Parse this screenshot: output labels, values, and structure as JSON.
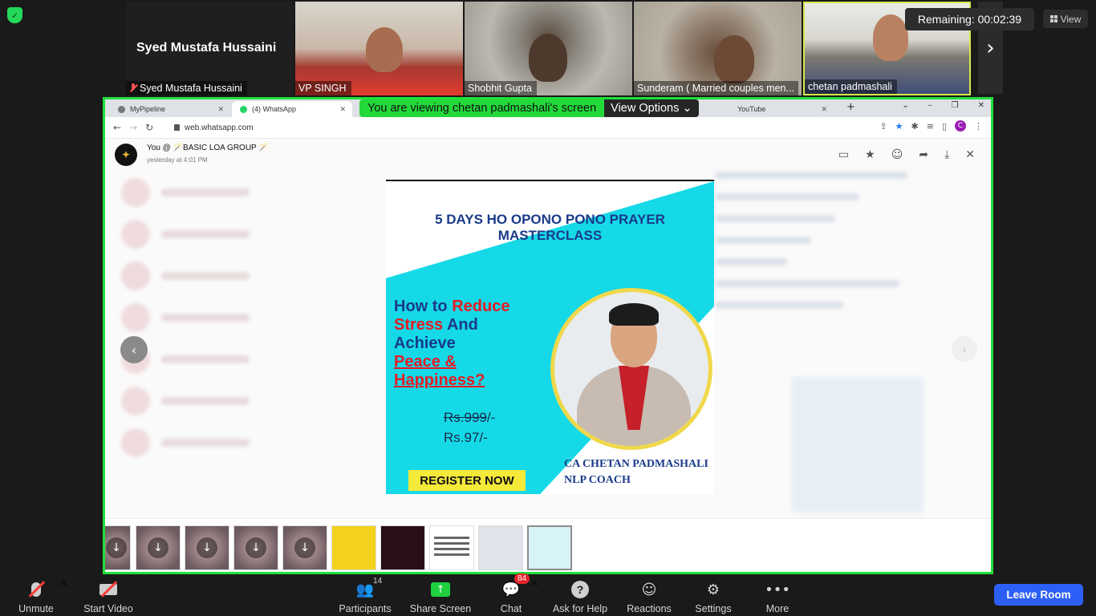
{
  "security": {
    "icon": "shield-check-icon"
  },
  "gallery": [
    {
      "name": "Syed Mustafa Hussaini",
      "big_name": "Syed Mustafa Hussaini",
      "muted": true
    },
    {
      "name": "VP SINGH"
    },
    {
      "name": "Shobhit Gupta"
    },
    {
      "name": "Sunderam ( Married couples men..."
    },
    {
      "name": "chetan padmashali",
      "active": true
    }
  ],
  "remaining": "Remaining: 00:02:39",
  "view_label": "View",
  "share": {
    "banner_text": "You are viewing chetan padmashali's screen",
    "view_options": "View Options",
    "tabs": [
      {
        "label": "MyPipeline"
      },
      {
        "label": "(4) WhatsApp"
      },
      {
        "label": "YouTube"
      }
    ],
    "url": "web.whatsapp.com",
    "avatar_letter": "C",
    "viewer": {
      "sender": "You @ 🪄BASIC LOA GROUP 🪄",
      "time": "yesterday at 4:01 PM"
    },
    "poster": {
      "title_line1": "5 DAYS HO OPONO PONO PRAYER",
      "title_line2": "MASTERCLASS",
      "q1_a": "How to ",
      "q1_b": "Reduce",
      "q2_a": "Stress",
      "q2_b": " And",
      "q3": "Achieve",
      "q4": "Peace &",
      "q5": "Happiness?",
      "old_price": "Rs.999",
      "old_price_suffix": "/-",
      "new_price": "Rs.97/-",
      "register": "REGISTER NOW",
      "coach1": "CA CHETAN PADMASHALI",
      "coach2": "NLP COACH"
    }
  },
  "toolbar": {
    "unmute": "Unmute",
    "start_video": "Start Video",
    "participants": "Participants",
    "participants_count": "14",
    "share_screen": "Share Screen",
    "chat": "Chat",
    "chat_badge": "84",
    "help": "Ask for Help",
    "reactions": "Reactions",
    "settings": "Settings",
    "more": "More",
    "leave": "Leave Room"
  }
}
